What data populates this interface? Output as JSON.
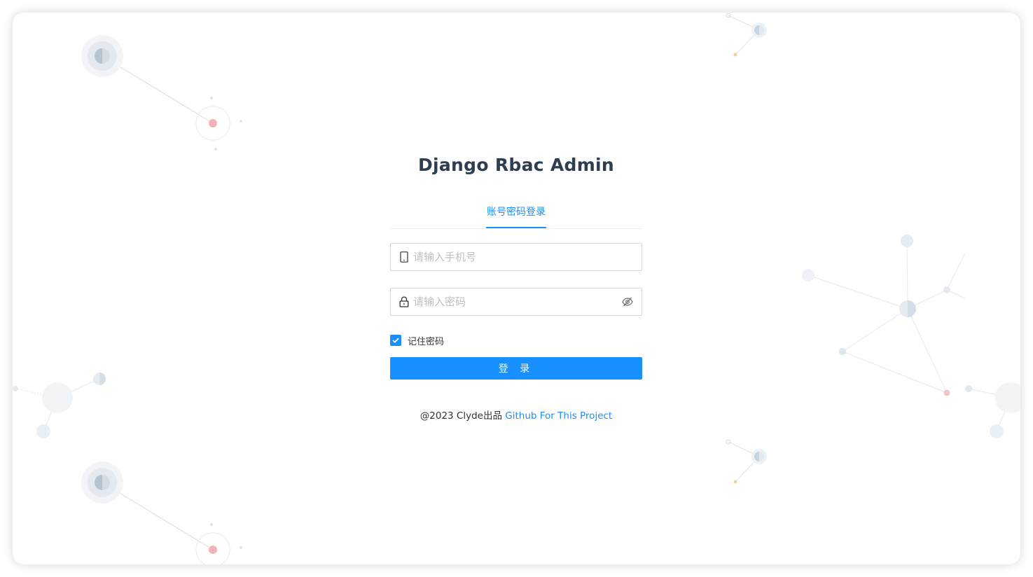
{
  "app": {
    "title": "Django Rbac Admin"
  },
  "tabs": [
    {
      "label": "账号密码登录",
      "active": true
    }
  ],
  "form": {
    "phone_placeholder": "请输入手机号",
    "phone_icon": "mobile-icon",
    "password_placeholder": "请输入密码",
    "password_icon": "lock-icon",
    "visibility_icon": "eye-invisible-icon",
    "remember_label": "记住密码",
    "remember_checked": true,
    "submit_label": "登 录"
  },
  "footer": {
    "copyright": "@2023 Clyde出品",
    "link_text": "Github For This Project"
  },
  "colors": {
    "primary": "#1890ff",
    "title": "#2c3e50",
    "placeholder": "#bfbfbf"
  }
}
